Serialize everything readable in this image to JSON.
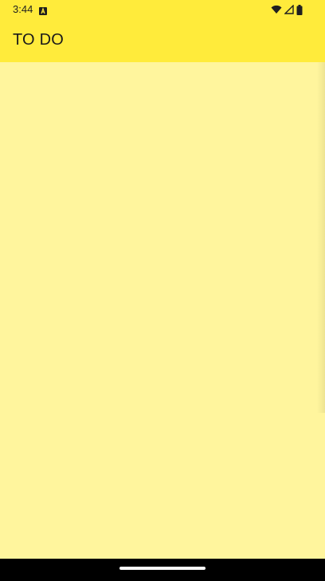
{
  "status_bar": {
    "time": "3:44",
    "icons": [
      "notification-a-icon",
      "wifi-icon",
      "cellular-signal-icon",
      "battery-icon"
    ]
  },
  "app_bar": {
    "title": "TO DO"
  },
  "colors": {
    "app_bar": "#FFEB3B",
    "background": "#FFF59D",
    "nav_bar": "#000000"
  }
}
